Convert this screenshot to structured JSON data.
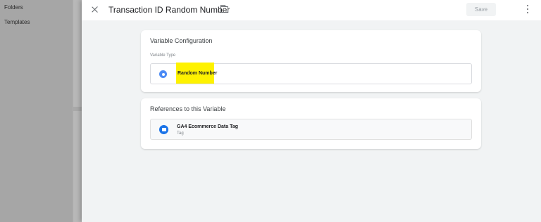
{
  "background": {
    "sidebar": {
      "items": [
        {
          "label": "Folders"
        },
        {
          "label": "Templates"
        }
      ]
    }
  },
  "panel": {
    "title": "Transaction ID Random Number",
    "save_label": "Save",
    "config_card": {
      "title": "Variable Configuration",
      "field_label": "Variable Type",
      "variable_type": "Random Number",
      "type_icon": "gear-icon",
      "highlight_color": "#fef200"
    },
    "references_card": {
      "title": "References to this Variable",
      "items": [
        {
          "name": "GA4 Ecommerce Data Tag",
          "kind": "Tag",
          "icon": "tag-icon"
        }
      ]
    }
  }
}
